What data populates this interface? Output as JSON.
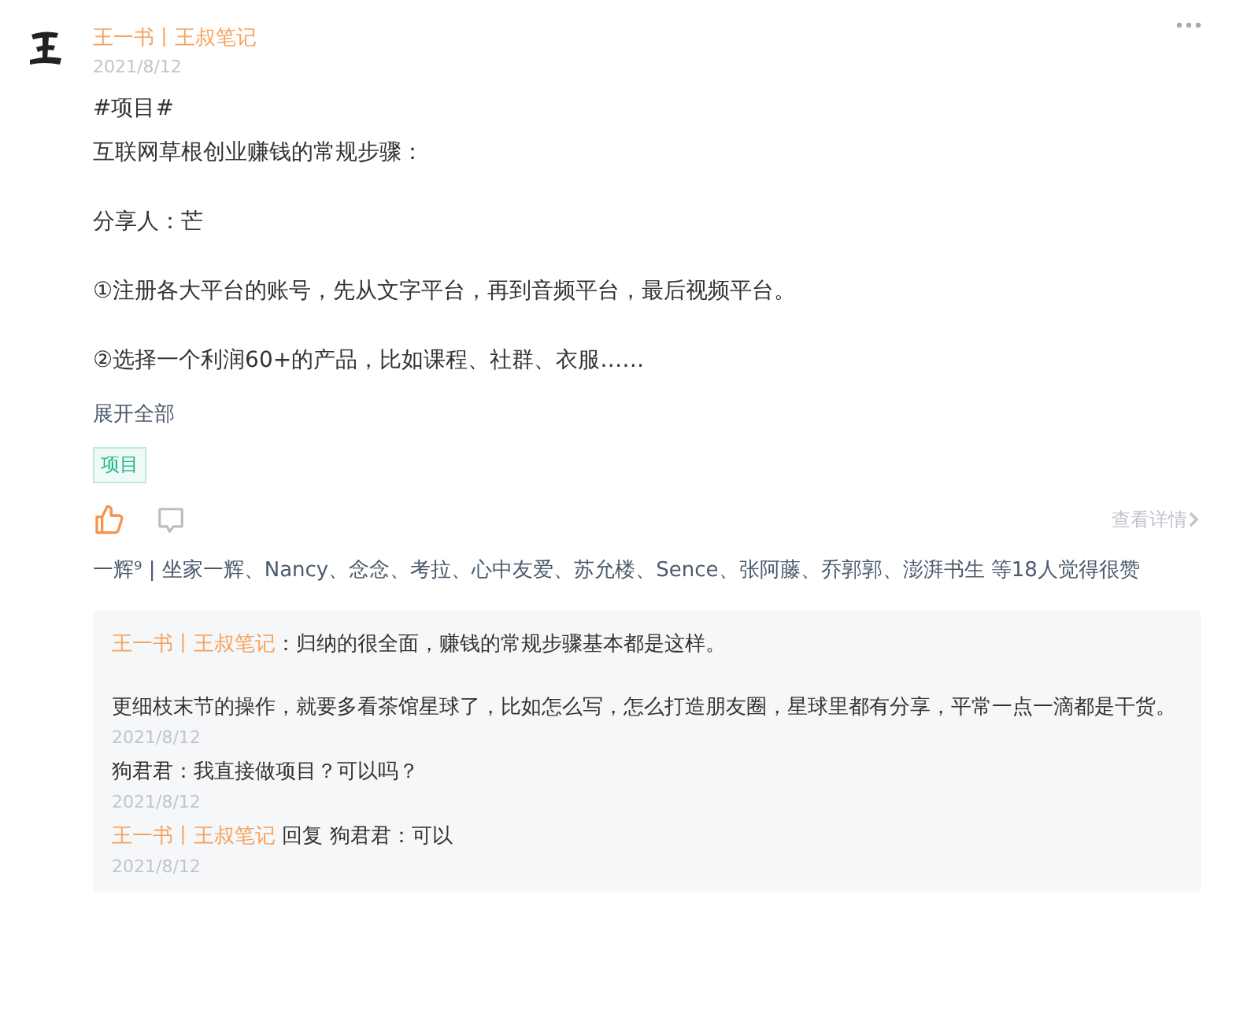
{
  "post": {
    "author": "王一书丨王叔笔记",
    "date": "2021/8/12",
    "blocks": [
      [
        "#项目#",
        "互联网草根创业赚钱的常规步骤："
      ],
      [
        "分享人：芒"
      ],
      [
        "①注册各大平台的账号，先从文字平台，再到音频平台，最后视频平台。"
      ],
      [
        "②选择一个利润60+的产品，比如课程、社群、衣服……"
      ]
    ],
    "expand": "展开全部",
    "tags": [
      "项目"
    ],
    "liked": true,
    "details": "查看详情",
    "likers": "一辉⁹ | 坐家一辉、Nancy、念念、考拉、心中友爱、苏允楼、Sence、张阿藤、乔郭郭、澎湃书生",
    "likes_summary": "等18人觉得很赞"
  },
  "comments": [
    {
      "author": "王一书丨王叔笔记",
      "owner": true,
      "paragraphs": [
        "：归纳的很全面，赚钱的常规步骤基本都是这样。",
        "更细枝末节的操作，就要多看茶馆星球了，比如怎么写，怎么打造朋友圈，星球里都有分享，平常一点一滴都是干货。"
      ],
      "date": "2021/8/12"
    },
    {
      "author": "狗君君",
      "owner": false,
      "paragraphs": [
        "：我直接做项目？可以吗？"
      ],
      "date": "2021/8/12"
    },
    {
      "author": "王一书丨王叔笔记",
      "owner": true,
      "reply_to": "回复 狗君君",
      "paragraphs": [
        "：可以"
      ],
      "date": "2021/8/12"
    }
  ]
}
